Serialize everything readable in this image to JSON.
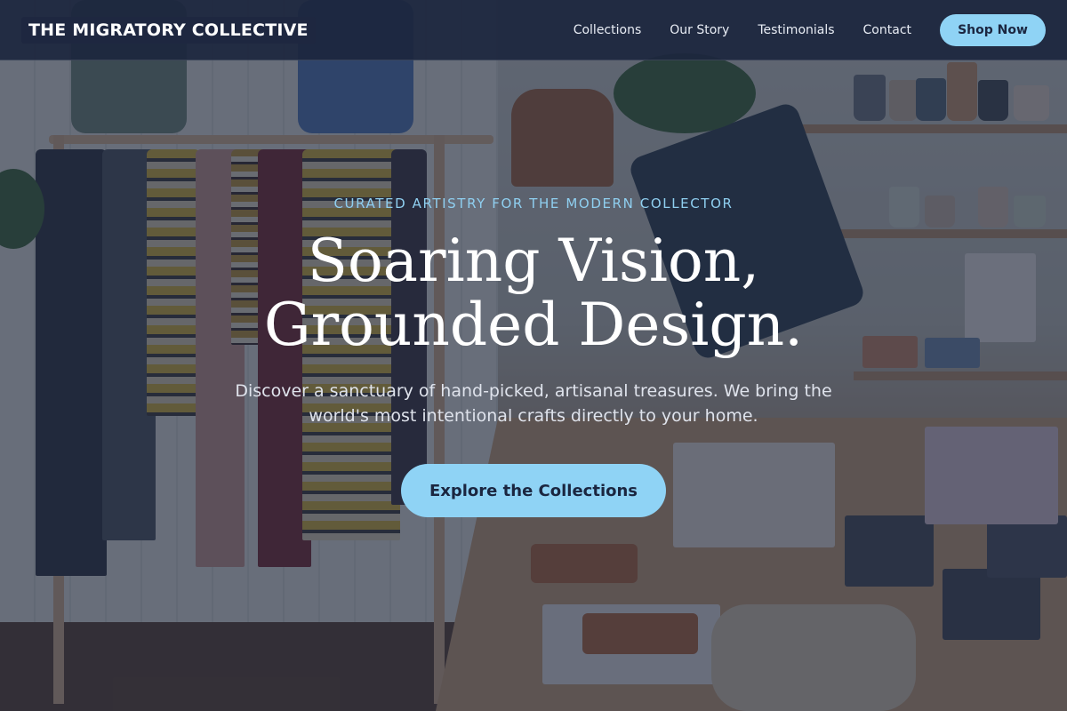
{
  "brand": {
    "name": "THE MIGRATORY COLLECTIVE"
  },
  "nav": {
    "items": [
      {
        "label": "Collections"
      },
      {
        "label": "Our Story"
      },
      {
        "label": "Testimonials"
      },
      {
        "label": "Contact"
      }
    ],
    "cta_label": "Shop Now"
  },
  "hero": {
    "eyebrow": "CURATED ARTISTRY FOR THE MODERN COLLECTOR",
    "headline_line1": "Soaring Vision,",
    "headline_line2": "Grounded Design.",
    "subcopy": "Discover a sanctuary of hand-picked, artisanal treasures. We bring the world's most intentional crafts directly to your home.",
    "cta_label": "Explore the Collections"
  },
  "colors": {
    "accent": "#8fd3f5",
    "header_bg": "#1c263e",
    "overlay": "#1c243a",
    "text_primary": "#ffffff"
  }
}
